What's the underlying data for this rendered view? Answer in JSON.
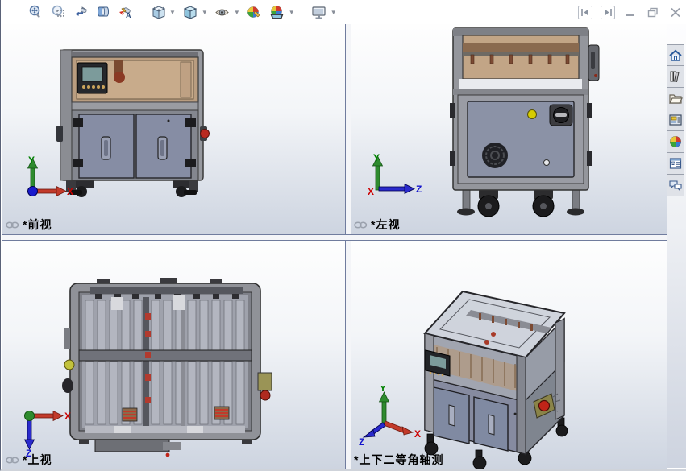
{
  "window": {
    "controls": [
      "collapse-pane-left",
      "collapse-pane-right",
      "minimize",
      "restore",
      "close"
    ]
  },
  "toolbar": {
    "items": [
      {
        "name": "zoom-to-fit",
        "dropdown": false
      },
      {
        "name": "zoom-to-area",
        "dropdown": false
      },
      {
        "name": "previous-view",
        "dropdown": false
      },
      {
        "name": "section-view",
        "dropdown": false
      },
      {
        "name": "annotation-views",
        "dropdown": false
      },
      {
        "name": "view-orientation",
        "dropdown": true
      },
      {
        "name": "display-style",
        "dropdown": true
      },
      {
        "name": "hide-show-items",
        "dropdown": true
      },
      {
        "name": "edit-appearance",
        "dropdown": false
      },
      {
        "name": "apply-scene",
        "dropdown": true
      },
      {
        "name": "view-settings",
        "dropdown": true
      }
    ]
  },
  "taskpane": {
    "tabs": [
      "home",
      "design-library",
      "file-explorer",
      "view-palette",
      "appearances",
      "custom-properties",
      "forum"
    ]
  },
  "axes": {
    "x": "X",
    "y": "Y",
    "z": "Z"
  },
  "viewports": {
    "front": {
      "label": "*前视",
      "linked": true
    },
    "left": {
      "label": "*左视",
      "linked": true
    },
    "top": {
      "label": "*上视",
      "linked": true
    },
    "iso": {
      "label": "*上下二等角轴测",
      "linked": false
    }
  },
  "colors": {
    "axis_x": "#cc0000",
    "axis_y": "#008000",
    "axis_z": "#1414cc",
    "splitter": "#707c9e",
    "viewport_gradient_bottom": "#cdd4e0",
    "machine_frame": "#97999f",
    "machine_door": "#868da4",
    "machine_window_amber": "#c0a383",
    "estop_red": "#b92a20",
    "lamp_yellow": "#d6cc00"
  }
}
